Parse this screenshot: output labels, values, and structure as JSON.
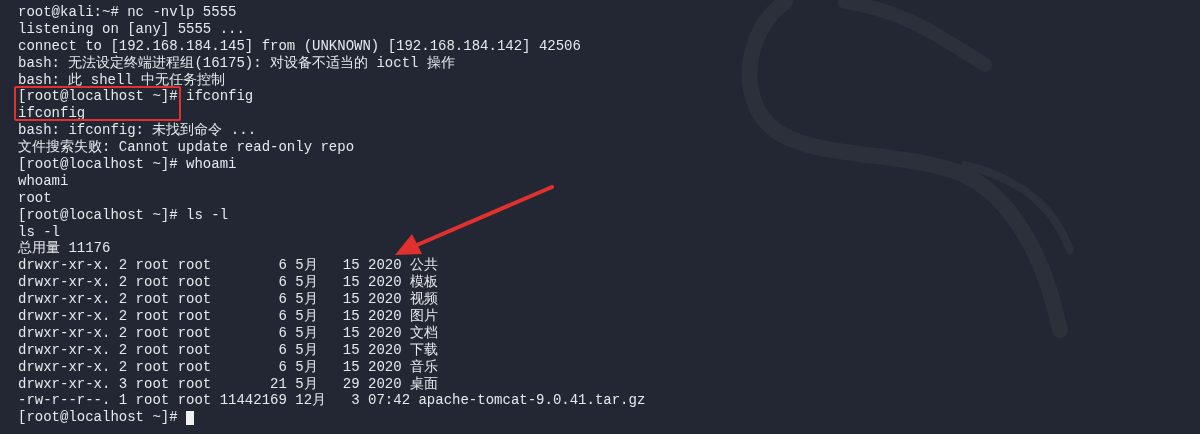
{
  "terminal": {
    "lines": [
      {
        "prompt": "root@kali:~#",
        "command": "nc -nvlp 5555"
      },
      "listening on [any] 5555 ...",
      "connect to [192.168.184.145] from (UNKNOWN) [192.168.184.142] 42506",
      "bash: 无法设定终端进程组(16175): 对设备不适当的 ioctl 操作",
      "bash: 此 shell 中无任务控制",
      {
        "prompt": "[root@localhost ~]#",
        "command": "ifconfig"
      },
      "ifconfig",
      "bash: ifconfig: 未找到命令 ...",
      "文件搜索失败: Cannot update read-only repo",
      {
        "prompt": "[root@localhost ~]#",
        "command": "whoami"
      },
      "whoami",
      "root",
      {
        "prompt": "[root@localhost ~]#",
        "command": "ls -l"
      },
      "ls -l",
      "总用量 11176",
      "drwxr-xr-x. 2 root root        6 5月   15 2020 公共",
      "drwxr-xr-x. 2 root root        6 5月   15 2020 模板",
      "drwxr-xr-x. 2 root root        6 5月   15 2020 视频",
      "drwxr-xr-x. 2 root root        6 5月   15 2020 图片",
      "drwxr-xr-x. 2 root root        6 5月   15 2020 文档",
      "drwxr-xr-x. 2 root root        6 5月   15 2020 下载",
      "drwxr-xr-x. 2 root root        6 5月   15 2020 音乐",
      "drwxr-xr-x. 3 root root       21 5月   29 2020 桌面",
      "-rw-r--r--. 1 root root 11442169 12月   3 07:42 apache-tomcat-9.0.41.tar.gz",
      {
        "prompt": "[root@localhost ~]#"
      }
    ]
  }
}
